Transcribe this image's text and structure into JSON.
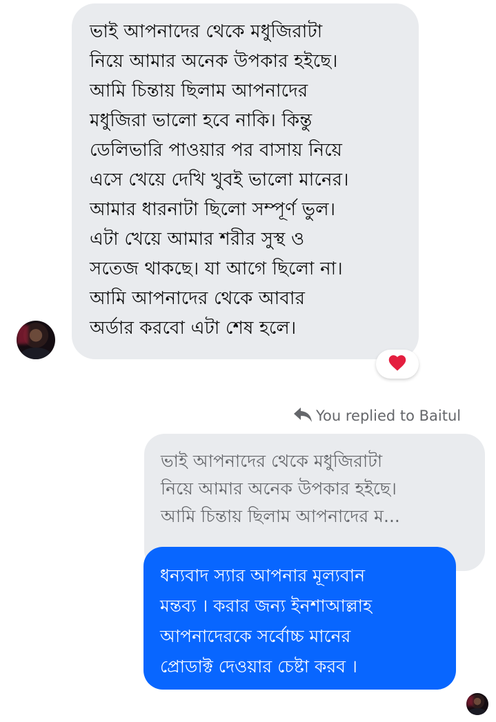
{
  "incoming_message": {
    "lines": [
      "ভাই আপনাদের থেকে মধুজিরাটা",
      "নিয়ে আমার অনেক উপকার হইছে।",
      "আমি চিন্তায় ছিলাম আপনাদের",
      "মধুজিরা ভালো হবে নাকি। কিন্তু",
      "ডেলিভারি পাওয়ার পর বাসায় নিয়ে",
      "এসে খেয়ে দেখি খুবই ভালো মানের।",
      "আমার ধারনাটা ছিলো সম্পূর্ণ ভুল।",
      "এটা খেয়ে আমার শরীর সুস্থ ও",
      "সতেজ থাকছে। যা আগে ছিলো না।",
      "আমি আপনাদের থেকে আবার",
      "অর্ডার করবো এটা শেষ হলে।"
    ],
    "reaction": "heart-icon"
  },
  "reply_indicator": {
    "label": "You replied to Baitul",
    "icon": "reply-arrow-icon"
  },
  "quoted_message": {
    "lines": [
      "ভাই আপনাদের থেকে মধুজিরাটা",
      "নিয়ে আমার অনেক উপকার হইছে।",
      "আমি চিন্তায় ছিলাম আপনাদের ম..."
    ]
  },
  "outgoing_message": {
    "lines": [
      "ধন্যবাদ স্যার আপনার মূল্যবান",
      "মন্তব্য । করার জন্য ইনশাআল্লাহ",
      "আপনাদেরকে সর্বোচ্চ মানের",
      "প্রোডাক্ট দেওয়ার চেষ্টা করব ।"
    ]
  },
  "colors": {
    "incoming_bubble": "#e9ebee",
    "outgoing_bubble": "#0866ff",
    "secondary_text": "#65676b",
    "reaction_heart": "#e41e3f"
  }
}
